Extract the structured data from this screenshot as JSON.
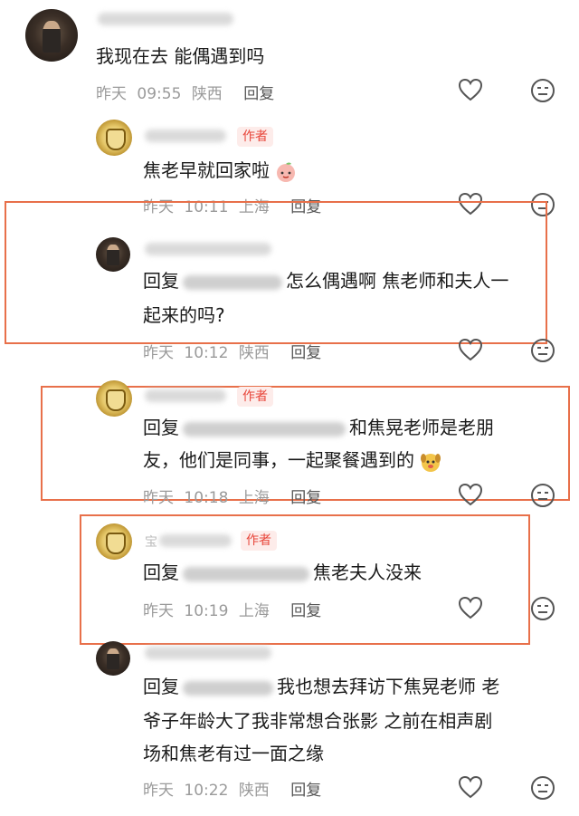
{
  "comments": [
    {
      "text_line1": "我现在去 能偶遇到吗",
      "date": "昨天",
      "time": "09:55",
      "location": "陕西",
      "reply_label": "回复"
    },
    {
      "author_badge": "作者",
      "text_line1": "焦老早就回家啦",
      "date": "昨天",
      "time": "10:11",
      "location": "上海",
      "reply_label": "回复"
    },
    {
      "text_prefix": "回复",
      "text_line1_rest": "怎么偶遇啊 焦老师和夫人一",
      "text_line2": "起来的吗?",
      "date": "昨天",
      "time": "10:12",
      "location": "陕西",
      "reply_label": "回复"
    },
    {
      "author_badge": "作者",
      "text_prefix": "回复",
      "text_line1_rest": "和焦晃老师是老朋",
      "text_line2": "友，他们是同事，一起聚餐遇到的",
      "date": "昨天",
      "time": "10:18",
      "location": "上海",
      "reply_label": "回复"
    },
    {
      "author_badge": "作者",
      "name_visible_char": "宝",
      "text_prefix": "回复",
      "text_line1_rest": "焦老夫人没来",
      "date": "昨天",
      "time": "10:19",
      "location": "上海",
      "reply_label": "回复"
    },
    {
      "text_prefix": "回复",
      "text_line1_rest": "我也想去拜访下焦晃老师 老",
      "text_line2": "爷子年龄大了我非常想合张影 之前在相声剧",
      "text_line3": "场和焦老有过一面之缘",
      "date": "昨天",
      "time": "10:22",
      "location": "陕西",
      "reply_label": "回复"
    }
  ],
  "icons": {
    "like": "heart-outline-icon",
    "dislike": "neutral-face-icon",
    "emoji_sticker_1": "peach-blush-emoji",
    "emoji_sticker_2": "puppy-face-emoji"
  },
  "colors": {
    "author_badge": "#e8463a",
    "highlight_box": "#e8704a",
    "meta_text": "#9a9a9a"
  }
}
